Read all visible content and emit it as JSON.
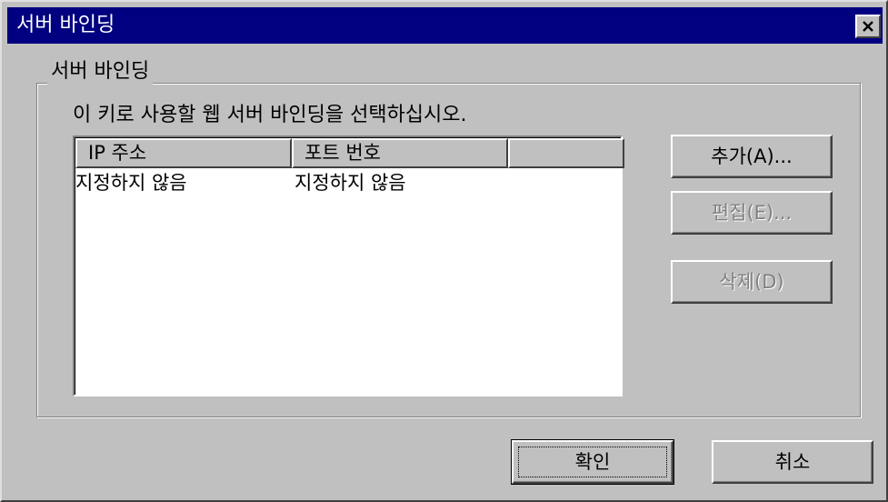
{
  "window": {
    "title": "서버 바인딩"
  },
  "group": {
    "label": "서버 바인딩",
    "instruction": "이 키로 사용할 웹 서버 바인딩을 선택하십시오."
  },
  "list": {
    "columns": [
      "IP 주소",
      "포트 번호",
      ""
    ],
    "rows": [
      [
        "지정하지 않음",
        "지정하지 않음"
      ]
    ]
  },
  "side_buttons": {
    "add": "추가(A)...",
    "edit": "편집(E)...",
    "delete": "삭제(D)"
  },
  "footer_buttons": {
    "ok": "확인",
    "cancel": "취소"
  },
  "colors": {
    "titlebar": "#000080",
    "face": "#c0c0c0",
    "disabled_text": "#808080"
  },
  "icons": {
    "close": "close-icon"
  }
}
